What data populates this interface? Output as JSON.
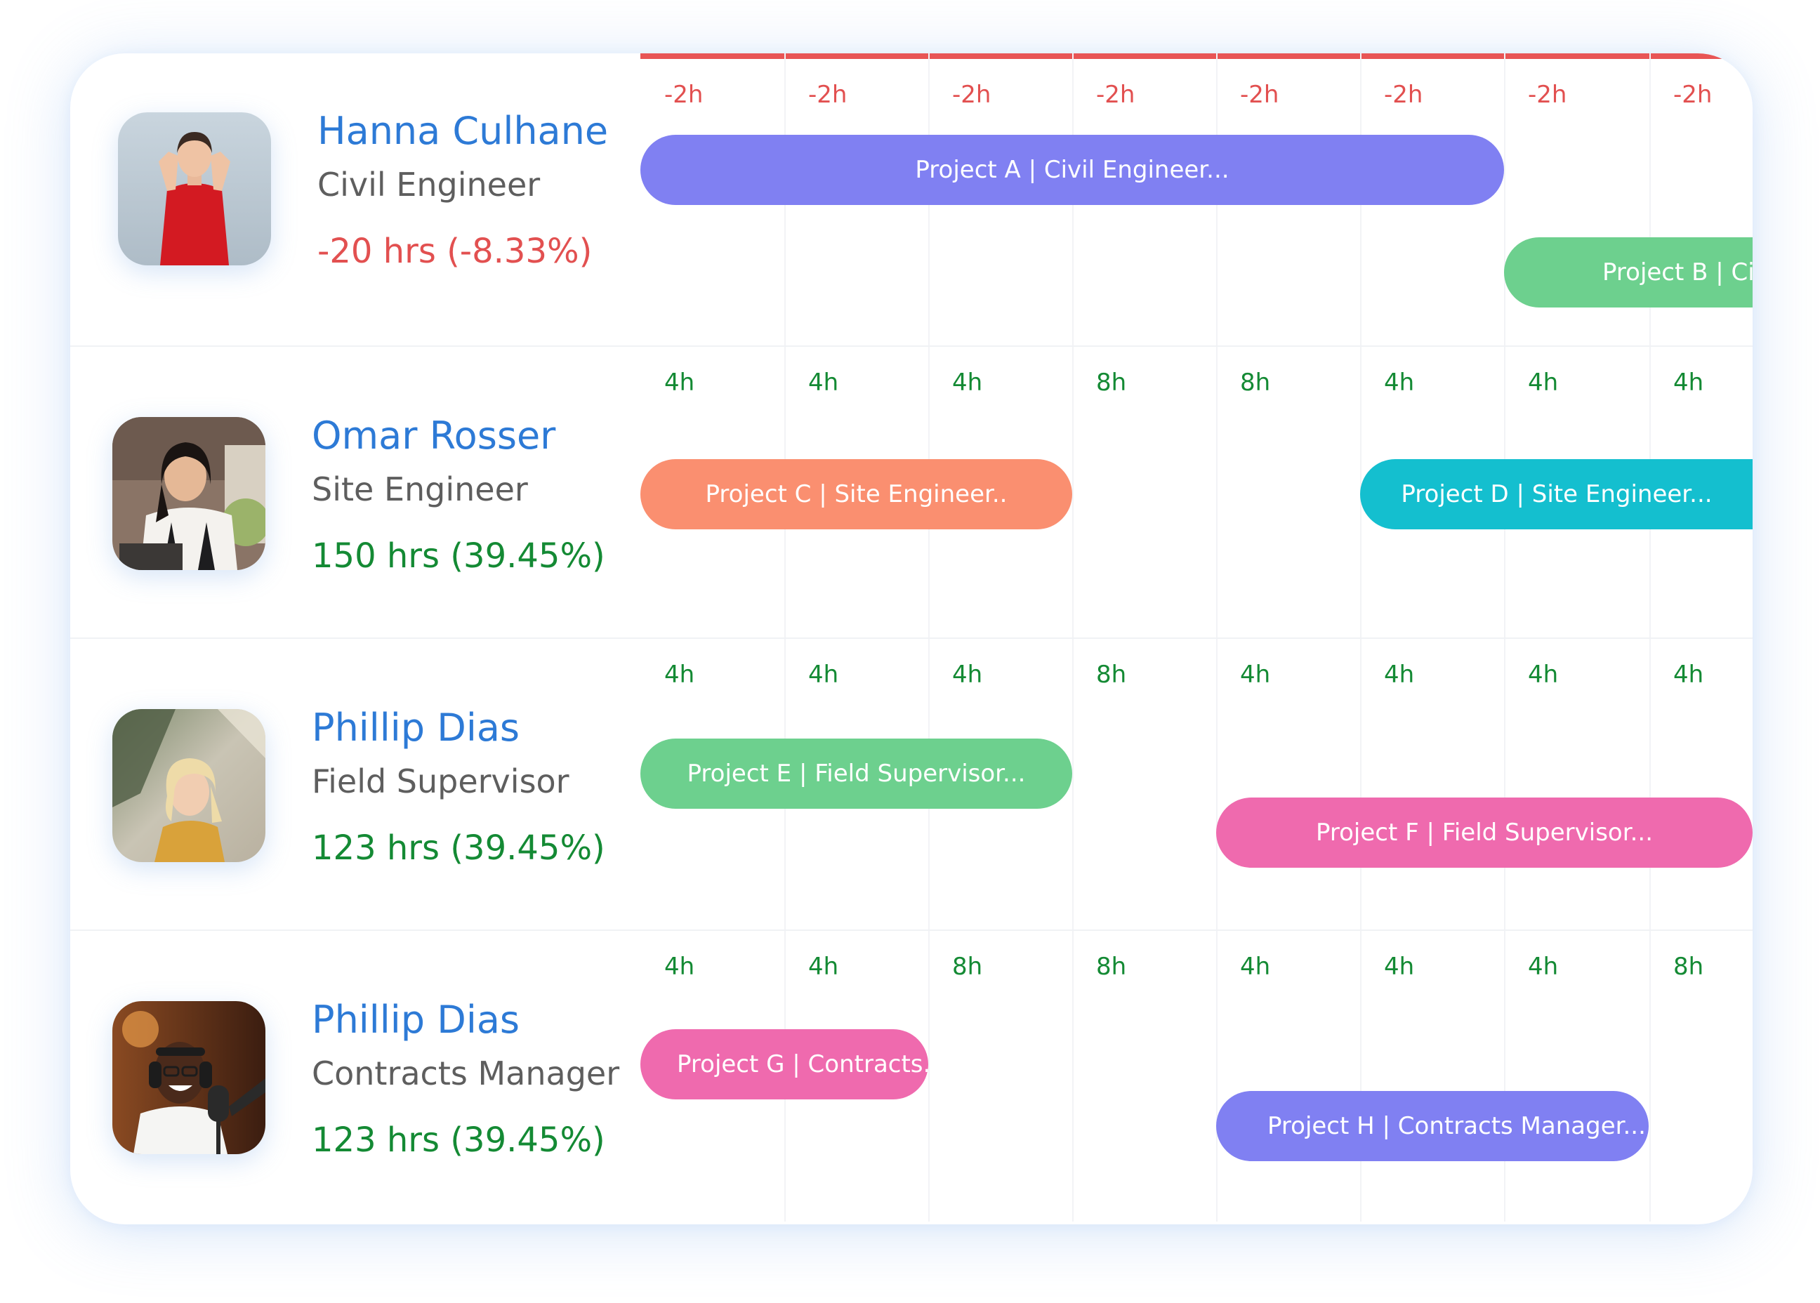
{
  "colors": {
    "name": "#2d7ad6",
    "negative": "#e25050",
    "positive": "#148a34",
    "header_line": "#e85555"
  },
  "people": [
    {
      "name": "Hanna Culhane",
      "role": "Civil Engineer",
      "hours": "-20 hrs (-8.33%)",
      "hours_status": "negative",
      "avatar_icon": "woman-red-top-photo",
      "slots": [
        "-2h",
        "-2h",
        "-2h",
        "-2h",
        "-2h",
        "-2h",
        "-2h",
        "-2h"
      ],
      "projects": [
        {
          "label": "Project A | Civil Engineer...",
          "color": "#8080f2"
        },
        {
          "label": "Project B | Civil Engineer...",
          "color": "#6dd08e"
        }
      ]
    },
    {
      "name": "Omar Rosser",
      "role": "Site Engineer",
      "hours": "150 hrs (39.45%)",
      "hours_status": "positive",
      "avatar_icon": "woman-smiling-kitchen-photo",
      "slots": [
        "4h",
        "4h",
        "4h",
        "8h",
        "8h",
        "4h",
        "4h",
        "4h"
      ],
      "projects": [
        {
          "label": "Project C | Site Engineer..",
          "color": "#fa8f70"
        },
        {
          "label": "Project D | Site Engineer...",
          "color": "#14bfcf"
        }
      ]
    },
    {
      "name": "Phillip Dias",
      "role": "Field Supervisor",
      "hours": "123 hrs (39.45%)",
      "hours_status": "positive",
      "avatar_icon": "woman-blonde-outdoor-photo",
      "slots": [
        "4h",
        "4h",
        "4h",
        "8h",
        "4h",
        "4h",
        "4h",
        "4h"
      ],
      "projects": [
        {
          "label": "Project E | Field Supervisor...",
          "color": "#6dd08e"
        },
        {
          "label": "Project F | Field Supervisor...",
          "color": "#ef6aae"
        }
      ]
    },
    {
      "name": "Phillip Dias",
      "role": "Contracts Manager",
      "hours": "123 hrs (39.45%)",
      "hours_status": "positive",
      "avatar_icon": "man-headphones-microphone-photo",
      "slots": [
        "4h",
        "4h",
        "8h",
        "8h",
        "4h",
        "4h",
        "4h",
        "8h"
      ],
      "projects": [
        {
          "label": "Project G | Contracts..",
          "color": "#ef6aae"
        },
        {
          "label": "Project H | Contracts Manager...",
          "color": "#8080f2"
        }
      ]
    }
  ]
}
